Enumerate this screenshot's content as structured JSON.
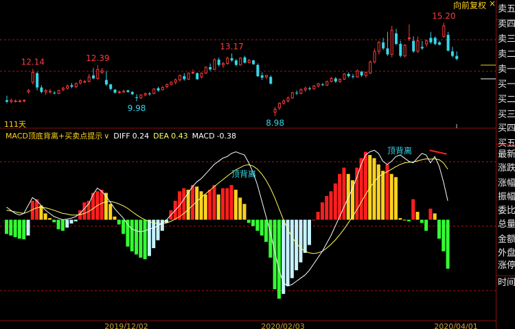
{
  "header": {
    "restore_button": "向前复权",
    "close_glyph": "×"
  },
  "price_chart": {
    "period_label": "111天",
    "annotations": [
      {
        "text": "12.14",
        "color": "#ff3c3c"
      },
      {
        "text": "12.39",
        "color": "#ff3c3c"
      },
      {
        "text": "13.17",
        "color": "#ff3c3c"
      },
      {
        "text": "15.20",
        "color": "#ff3c3c"
      },
      {
        "text": "9.98",
        "color": "#36d6e8"
      },
      {
        "text": "8.98",
        "color": "#36d6e8"
      }
    ]
  },
  "indicator_bar": {
    "name": "MACD顶底背离+买卖点提示",
    "dropdown_glyph": "∨",
    "diff_label": "DIFF",
    "diff_value": "0.24",
    "dea_label": "DEA",
    "dea_value": "0.43",
    "macd_label": "MACD",
    "macd_value": "-0.38",
    "divergence_labels": [
      "顶背离",
      "顶背离"
    ]
  },
  "x_axis": {
    "dates": [
      "2019/12/02",
      "2020/02/03",
      "2020/04/01"
    ]
  },
  "right_panel": {
    "items": [
      "卖五",
      "卖四",
      "卖三",
      "卖二",
      "卖一",
      "买一",
      "买二",
      "买三",
      "买四",
      "买五",
      "最新",
      "涨跌",
      "涨幅",
      "振幅",
      "委比",
      "总量",
      "金额",
      "外盘",
      "涨停"
    ],
    "time_label": "时间"
  },
  "colors": {
    "up": "#ff3c3c",
    "down": "#36d6e8",
    "hist_pos_red": "#ff1e1e",
    "hist_pos_yellow": "#ffd21e",
    "hist_neg_green": "#33ff33",
    "hist_neg_light": "#c6f3ff",
    "grid": "#b01515",
    "diff_line": "#ffffff",
    "dea_line": "#ffff66",
    "text_yellow": "#ffd21e"
  },
  "chart_data": [
    {
      "type": "candlestick",
      "title": "",
      "x_date_ticks": [
        "2019/12/02",
        "2020/02/03",
        "2020/04/01"
      ],
      "ylim": [
        8.6,
        15.9
      ],
      "ohlc": [
        [
          10.05,
          10.35,
          9.85,
          9.95
        ],
        [
          9.95,
          10.15,
          9.85,
          10.05
        ],
        [
          10.0,
          10.1,
          9.9,
          10.0
        ],
        [
          10.0,
          10.1,
          9.9,
          10.0
        ],
        [
          10.0,
          10.1,
          9.9,
          10.05
        ],
        [
          10.6,
          10.8,
          10.5,
          10.7
        ],
        [
          11.25,
          12.14,
          11.1,
          11.9
        ],
        [
          11.85,
          11.95,
          10.7,
          10.9
        ],
        [
          10.9,
          11.05,
          10.5,
          10.6
        ],
        [
          10.6,
          10.8,
          10.4,
          10.7
        ],
        [
          10.6,
          10.8,
          10.5,
          10.65
        ],
        [
          10.55,
          10.65,
          10.45,
          10.5
        ],
        [
          10.5,
          10.75,
          10.45,
          10.7
        ],
        [
          10.75,
          10.95,
          10.65,
          10.85
        ],
        [
          10.85,
          11.1,
          10.75,
          11.0
        ],
        [
          11.05,
          11.2,
          10.85,
          10.95
        ],
        [
          10.95,
          11.25,
          10.85,
          11.15
        ],
        [
          11.2,
          11.45,
          11.1,
          11.35
        ],
        [
          11.3,
          11.4,
          11.2,
          11.3
        ],
        [
          11.3,
          11.8,
          11.25,
          11.6
        ],
        [
          11.7,
          12.2,
          11.45,
          11.5
        ],
        [
          11.5,
          12.39,
          11.4,
          12.1
        ],
        [
          11.9,
          12.2,
          11.8,
          12.0
        ],
        [
          11.4,
          12.0,
          11.0,
          11.1
        ],
        [
          11.1,
          11.15,
          10.7,
          10.8
        ],
        [
          10.75,
          10.8,
          10.5,
          10.55
        ],
        [
          10.6,
          10.7,
          10.5,
          10.6
        ],
        [
          10.6,
          10.75,
          10.55,
          10.65
        ],
        [
          10.7,
          10.75,
          10.55,
          10.6
        ],
        [
          10.6,
          10.65,
          10.4,
          10.45
        ],
        [
          10.25,
          10.45,
          9.98,
          10.2
        ],
        [
          10.2,
          10.45,
          10.15,
          10.4
        ],
        [
          10.4,
          10.55,
          10.3,
          10.5
        ],
        [
          10.5,
          10.6,
          10.35,
          10.45
        ],
        [
          10.5,
          10.85,
          10.45,
          10.8
        ],
        [
          10.85,
          10.95,
          10.6,
          10.7
        ],
        [
          10.75,
          11.0,
          10.7,
          10.9
        ],
        [
          10.95,
          11.15,
          10.85,
          11.1
        ],
        [
          11.1,
          11.3,
          11.05,
          11.25
        ],
        [
          11.25,
          11.5,
          11.1,
          11.4
        ],
        [
          11.4,
          11.75,
          11.3,
          11.7
        ],
        [
          11.65,
          11.85,
          11.35,
          11.45
        ],
        [
          11.45,
          11.9,
          11.4,
          11.85
        ],
        [
          11.9,
          12.1,
          11.8,
          11.9
        ],
        [
          11.85,
          11.9,
          11.4,
          11.45
        ],
        [
          11.6,
          11.9,
          11.5,
          11.85
        ],
        [
          11.85,
          12.3,
          11.8,
          12.25
        ],
        [
          12.25,
          12.5,
          12.0,
          12.1
        ],
        [
          12.1,
          12.85,
          12.05,
          12.75
        ],
        [
          12.75,
          12.9,
          12.3,
          12.4
        ],
        [
          12.4,
          12.6,
          12.2,
          12.5
        ],
        [
          12.5,
          12.95,
          12.4,
          12.85
        ],
        [
          12.85,
          13.17,
          12.6,
          12.7
        ],
        [
          12.7,
          12.8,
          12.3,
          12.4
        ],
        [
          12.4,
          12.9,
          12.35,
          12.85
        ],
        [
          12.9,
          13.0,
          12.5,
          12.55
        ],
        [
          12.55,
          12.8,
          12.5,
          12.7
        ],
        [
          12.7,
          12.75,
          12.4,
          12.45
        ],
        [
          12.4,
          12.5,
          11.6,
          11.65
        ],
        [
          11.7,
          11.9,
          11.4,
          11.55
        ],
        [
          11.6,
          11.75,
          11.45,
          11.7
        ],
        [
          11.6,
          11.7,
          11.1,
          11.15
        ],
        [
          9.25,
          9.6,
          8.98,
          9.45
        ],
        [
          9.55,
          9.9,
          9.4,
          9.85
        ],
        [
          9.85,
          10.1,
          9.75,
          10.0
        ],
        [
          10.0,
          10.3,
          9.9,
          10.2
        ],
        [
          10.2,
          10.6,
          10.15,
          10.55
        ],
        [
          10.55,
          10.7,
          10.4,
          10.5
        ],
        [
          10.5,
          10.85,
          10.45,
          10.75
        ],
        [
          10.75,
          10.95,
          10.6,
          10.85
        ],
        [
          10.85,
          10.95,
          10.7,
          10.8
        ],
        [
          10.8,
          11.05,
          10.75,
          11.0
        ],
        [
          11.0,
          11.2,
          10.9,
          11.15
        ],
        [
          11.1,
          11.2,
          11.0,
          11.05
        ],
        [
          11.05,
          11.35,
          11.0,
          11.3
        ],
        [
          11.3,
          11.6,
          11.25,
          11.5
        ],
        [
          11.5,
          11.6,
          11.2,
          11.3
        ],
        [
          11.3,
          11.5,
          11.2,
          11.45
        ],
        [
          11.45,
          11.85,
          11.4,
          11.8
        ],
        [
          11.8,
          11.9,
          11.55,
          11.65
        ],
        [
          11.65,
          11.8,
          11.5,
          11.6
        ],
        [
          11.6,
          12.1,
          11.55,
          12.0
        ],
        [
          11.95,
          12.0,
          11.6,
          11.7
        ],
        [
          11.7,
          11.95,
          11.55,
          11.9
        ],
        [
          11.85,
          12.7,
          11.8,
          12.6
        ],
        [
          12.6,
          13.5,
          12.5,
          13.3
        ],
        [
          13.3,
          14.0,
          13.1,
          13.9
        ],
        [
          13.9,
          14.2,
          13.4,
          13.5
        ],
        [
          13.5,
          14.6,
          13.0,
          13.1
        ],
        [
          13.1,
          15.0,
          12.9,
          14.7
        ],
        [
          14.5,
          14.8,
          13.7,
          13.8
        ],
        [
          13.8,
          14.0,
          12.9,
          13.0
        ],
        [
          13.0,
          13.8,
          12.9,
          13.7
        ],
        [
          14.2,
          15.1,
          14.0,
          14.2
        ],
        [
          14.0,
          14.3,
          13.2,
          13.3
        ],
        [
          13.3,
          14.3,
          13.2,
          14.0
        ],
        [
          13.6,
          14.0,
          13.4,
          13.5
        ],
        [
          13.8,
          14.1,
          13.6,
          14.0
        ],
        [
          14.2,
          14.6,
          13.8,
          13.9
        ],
        [
          14.2,
          14.3,
          13.7,
          13.8
        ],
        [
          13.9,
          14.0,
          13.7,
          13.75
        ],
        [
          14.3,
          15.2,
          14.2,
          15.0
        ],
        [
          14.4,
          14.6,
          13.3,
          13.35
        ],
        [
          13.3,
          13.6,
          12.9,
          13.0
        ],
        [
          13.0,
          13.3,
          12.7,
          12.8
        ]
      ]
    },
    {
      "type": "bar",
      "title": "",
      "ylim": [
        -3.2,
        2.4
      ],
      "macd_hist": [
        -0.45,
        -0.5,
        -0.55,
        -0.6,
        -0.62,
        -0.5,
        0.6,
        0.65,
        0.45,
        0.2,
        0.05,
        -0.08,
        -0.3,
        -0.35,
        -0.25,
        -0.12,
        -0.05,
        0.3,
        0.55,
        0.6,
        0.85,
        0.9,
        0.95,
        0.85,
        0.5,
        0.1,
        -0.15,
        -0.45,
        -0.85,
        -1.0,
        -1.1,
        -1.2,
        -1.25,
        -1.15,
        -0.9,
        -0.65,
        -0.35,
        -0.1,
        0.3,
        0.6,
        0.9,
        1.0,
        0.95,
        1.1,
        1.05,
        0.9,
        0.8,
        0.95,
        1.1,
        0.8,
        1.0,
        1.0,
        1.1,
        0.95,
        0.7,
        0.5,
        -0.1,
        -0.2,
        -0.35,
        -0.5,
        -0.7,
        -1.2,
        -2.2,
        -2.5,
        -2.35,
        -2.1,
        -1.85,
        -1.6,
        -1.35,
        -1.05,
        -0.8,
        0.0,
        0.25,
        0.55,
        0.75,
        0.9,
        1.15,
        1.45,
        1.65,
        1.45,
        1.25,
        1.65,
        1.95,
        2.15,
        2.05,
        1.95,
        1.75,
        1.55,
        1.75,
        1.45,
        1.35,
        0.05,
        0.0,
        -0.05,
        0.65,
        0.25,
        -0.1,
        -0.35,
        0.35,
        0.2,
        -0.6,
        -1.0,
        -1.55
      ],
      "diff": [
        0.4,
        0.3,
        0.2,
        0.15,
        0.2,
        0.45,
        0.7,
        0.6,
        0.45,
        0.3,
        0.2,
        0.1,
        0.05,
        0.0,
        0.02,
        0.05,
        0.1,
        0.2,
        0.35,
        0.5,
        0.8,
        1.0,
        0.9,
        0.75,
        0.55,
        0.35,
        0.2,
        0.05,
        -0.15,
        -0.3,
        -0.35,
        -0.38,
        -0.35,
        -0.3,
        -0.25,
        -0.2,
        -0.1,
        0.0,
        0.15,
        0.3,
        0.45,
        0.65,
        0.85,
        1.05,
        1.2,
        1.3,
        1.45,
        1.6,
        1.75,
        1.85,
        1.95,
        2.0,
        2.1,
        2.15,
        2.1,
        2.05,
        1.8,
        1.5,
        1.1,
        0.6,
        0.1,
        -0.4,
        -1.0,
        -1.6,
        -2.0,
        -2.1,
        -2.05,
        -1.95,
        -1.85,
        -1.75,
        -1.6,
        -1.4,
        -1.2,
        -1.0,
        -0.75,
        -0.5,
        -0.2,
        0.1,
        0.4,
        0.7,
        1.0,
        1.35,
        1.75,
        2.05,
        2.15,
        2.2,
        2.1,
        1.85,
        1.75,
        1.85,
        2.0,
        2.05,
        1.95,
        1.85,
        1.8,
        1.95,
        2.1,
        2.05,
        1.8,
        2.0,
        1.7,
        1.2,
        0.6
      ],
      "dea": [
        0.3,
        0.28,
        0.25,
        0.22,
        0.2,
        0.25,
        0.32,
        0.38,
        0.4,
        0.38,
        0.34,
        0.3,
        0.25,
        0.2,
        0.18,
        0.15,
        0.15,
        0.16,
        0.2,
        0.26,
        0.35,
        0.45,
        0.52,
        0.57,
        0.58,
        0.55,
        0.5,
        0.44,
        0.36,
        0.26,
        0.16,
        0.07,
        0.0,
        -0.06,
        -0.1,
        -0.12,
        -0.12,
        -0.1,
        -0.05,
        0.02,
        0.1,
        0.2,
        0.32,
        0.45,
        0.58,
        0.7,
        0.82,
        0.93,
        1.05,
        1.16,
        1.27,
        1.38,
        1.48,
        1.58,
        1.65,
        1.72,
        1.74,
        1.7,
        1.6,
        1.45,
        1.25,
        1.0,
        0.7,
        0.35,
        0.0,
        -0.3,
        -0.55,
        -0.75,
        -0.9,
        -1.0,
        -1.05,
        -1.07,
        -1.05,
        -1.0,
        -0.9,
        -0.78,
        -0.64,
        -0.48,
        -0.3,
        -0.1,
        0.1,
        0.32,
        0.56,
        0.8,
        1.02,
        1.2,
        1.36,
        1.45,
        1.52,
        1.6,
        1.68,
        1.75,
        1.8,
        1.82,
        1.83,
        1.86,
        1.9,
        1.93,
        1.92,
        1.93,
        1.9,
        1.8,
        1.6
      ]
    }
  ]
}
